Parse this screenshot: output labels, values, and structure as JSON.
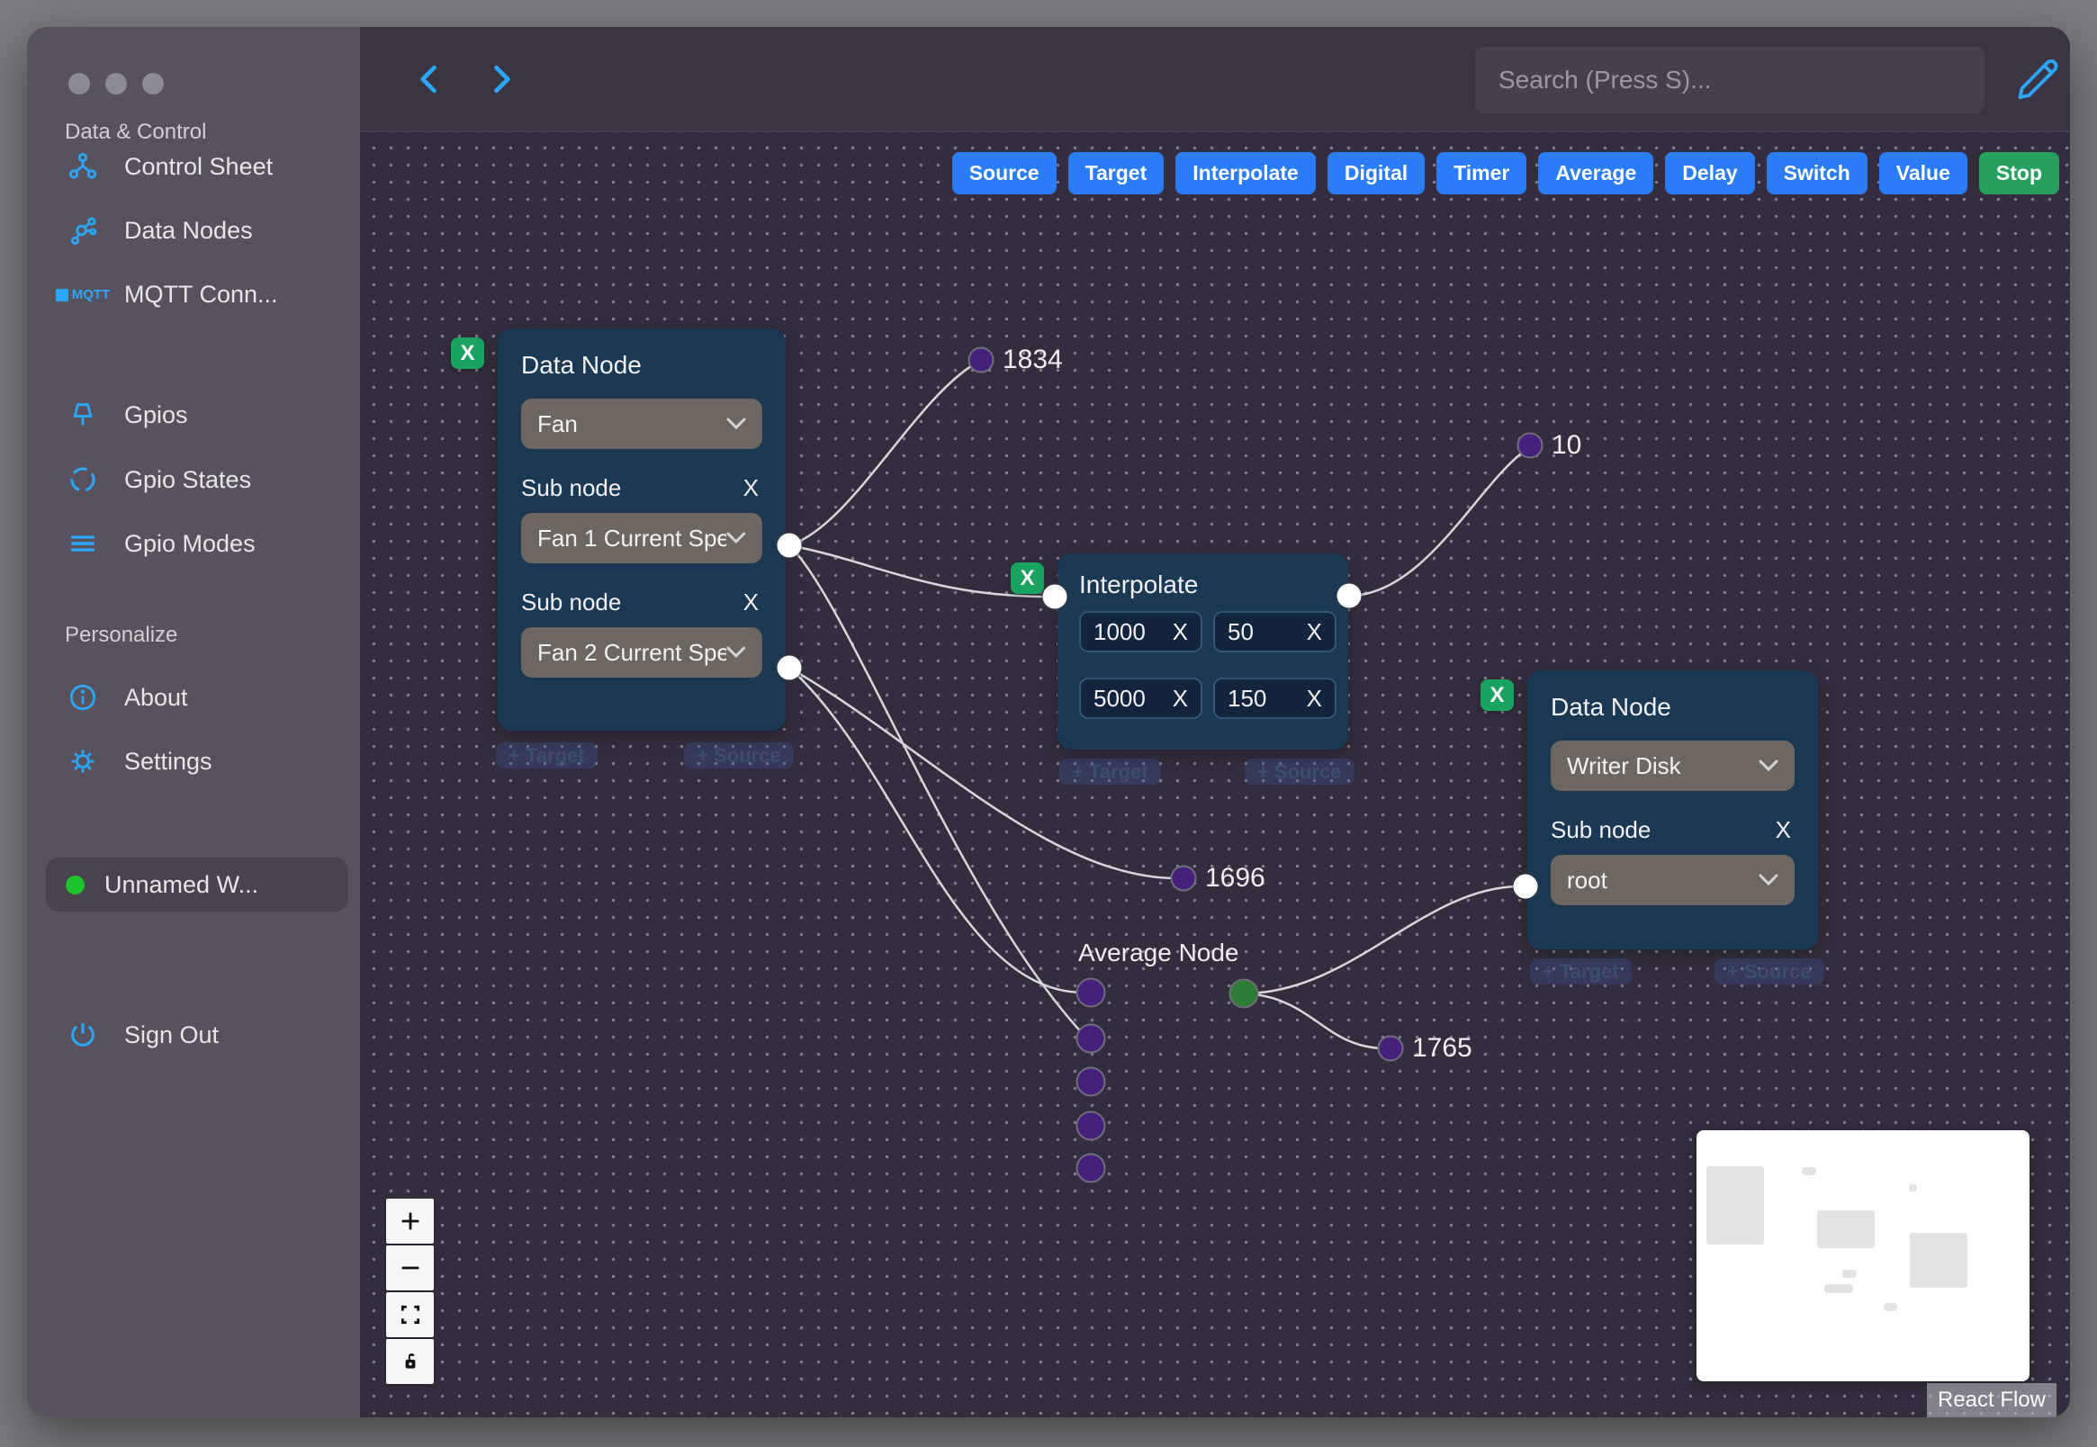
{
  "sidebar": {
    "section_data_control": "Data & Control",
    "control_sheet": "Control Sheet",
    "data_nodes": "Data Nodes",
    "mqtt": "MQTT Conn...",
    "mqtt_badge": "MQTT",
    "gpios": "Gpios",
    "gpio_states": "Gpio States",
    "gpio_modes": "Gpio Modes",
    "section_personalize": "Personalize",
    "about": "About",
    "settings": "Settings",
    "workspace": "Unnamed W...",
    "sign_out": "Sign Out"
  },
  "topbar": {
    "search_placeholder": "Search (Press S)..."
  },
  "toolbar": {
    "source": "Source",
    "target": "Target",
    "interpolate": "Interpolate",
    "digital": "Digital",
    "timer": "Timer",
    "average": "Average",
    "delay": "Delay",
    "switch": "Switch",
    "value": "Value",
    "stop": "Stop"
  },
  "nodes": {
    "remove_label": "X",
    "clear_label": "X",
    "add_target": "+ Target",
    "add_source": "+ Source",
    "fan": {
      "title": "Data Node",
      "type_value": "Fan",
      "sub_label": "Sub node",
      "sub1_value": "Fan 1 Current Spe",
      "sub2_value": "Fan 2 Current Spe"
    },
    "interpolate": {
      "title": "Interpolate",
      "v1": "1000",
      "v2": "50",
      "v3": "5000",
      "v4": "150"
    },
    "writer": {
      "title": "Data Node",
      "type_value": "Writer Disk",
      "sub_label": "Sub node",
      "sub1_value": "root"
    },
    "average": {
      "title": "Average Node"
    }
  },
  "edges": {
    "l1834": "1834",
    "l10": "10",
    "l1696": "1696",
    "l1765": "1765"
  },
  "attribution": "React Flow",
  "colors": {
    "accent_blue": "#2b7cf7",
    "accent_green": "#27a15f",
    "icon_blue": "#2ca6f6",
    "node_bg": "#1c3954",
    "purple_dot": "#45217d",
    "green_dot": "#2e7c36",
    "workspace_status": "#1fc32b"
  }
}
